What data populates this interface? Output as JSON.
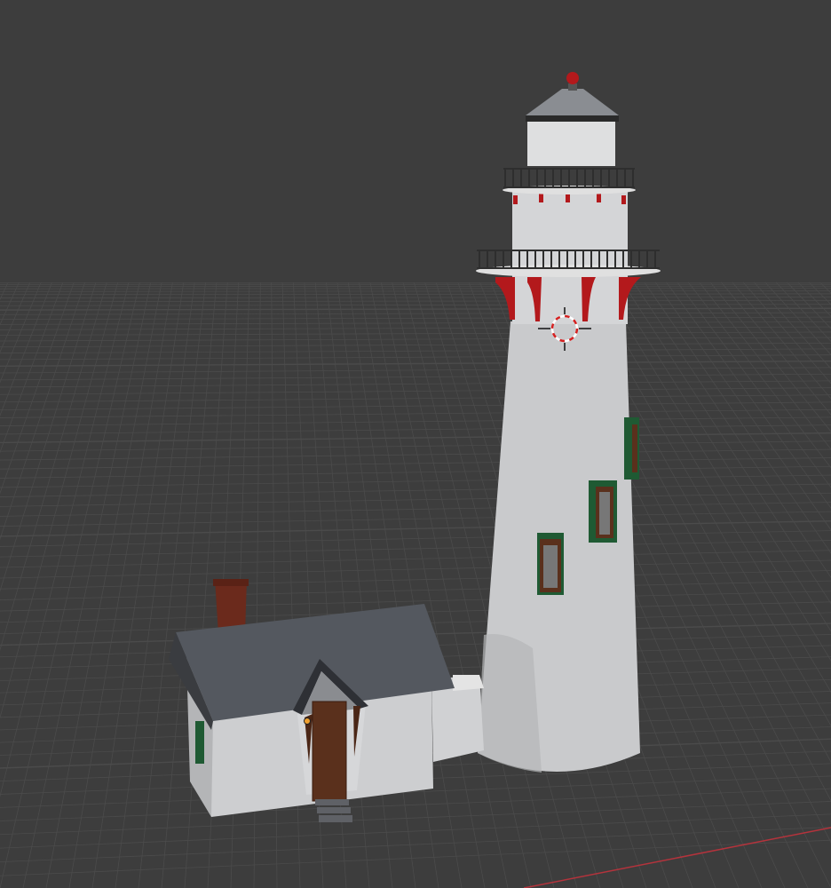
{
  "viewport": {
    "name": "3D Viewport",
    "scene_objects": [
      "lighthouse-tower",
      "keeper-house"
    ],
    "icons": [
      "3d-cursor-icon",
      "origin-dot-icon"
    ]
  },
  "colors": {
    "background": "#3d3d3d",
    "grid_line": "#4b4b4b",
    "x_axis": "#b4333c",
    "tower_white": "#c9cacc",
    "accent_red": "#b3191c",
    "window_green": "#1f5a33",
    "roof_gray": "#54585f",
    "door_brown": "#5a301c",
    "origin_dot": "#f0a030"
  }
}
